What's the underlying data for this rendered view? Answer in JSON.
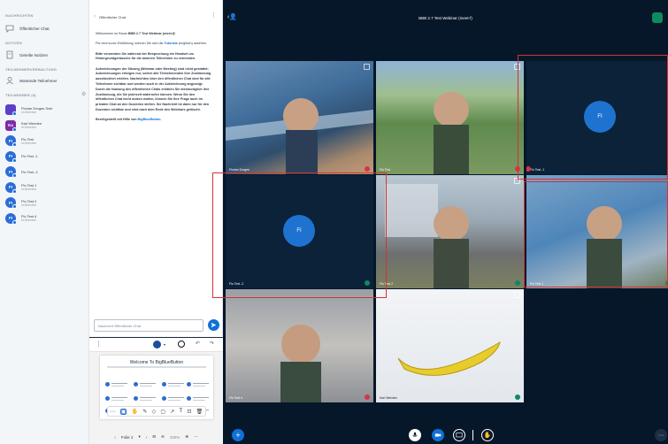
{
  "sidebar": {
    "messages_title": "NACHRICHTEN",
    "public_chat": "Öffentlicher Chat",
    "notes_title": "NOTIZEN",
    "shared_notes": "Geteilte Notizen",
    "management_title": "TEILNEHMERVERWALTUNG",
    "waiting_users": "Wartende Teilnehmer",
    "participants_title": "TEILNEHMER (8)",
    "users": [
      {
        "initials": "",
        "name": "Florian Dorges Schr",
        "sub": "im Betreiber",
        "color": "#5b3fc7"
      },
      {
        "initials": "Ka",
        "name": "Karl Wenden",
        "sub": "im Betreiber",
        "color": "#7b2aa8"
      },
      {
        "initials": "FI",
        "name": "Flo Test",
        "sub": "im Betreiber",
        "color": "#2b6cd6"
      },
      {
        "initials": "FI",
        "name": "Flo Test -1",
        "sub": "",
        "color": "#2b6cd6"
      },
      {
        "initials": "FI",
        "name": "Flo Test -2",
        "sub": "",
        "color": "#2b6cd6"
      },
      {
        "initials": "FI",
        "name": "Flo Test 1",
        "sub": "im Betreiber",
        "color": "#2b6cd6"
      },
      {
        "initials": "FI",
        "name": "Flo Test 2",
        "sub": "im Betreiber",
        "color": "#2b6cd6"
      },
      {
        "initials": "FI",
        "name": "Flo Test 4",
        "sub": "im Betreiber",
        "color": "#2b6cd6"
      }
    ]
  },
  "chat": {
    "title": "Öffentlicher Chat",
    "welcome_pre": "Willkommen im Raum ",
    "welcome_room": "BBB 2.7 Test Webinar (meet-f)",
    "welcome_post": "!",
    "p2_pre": "Für eine kurze Einführung, können Sie sich die ",
    "p2_link": "Tutorials",
    "p2_post": " (englisch) ansehen.",
    "p3": "Bitte verwenden Sie während der Besprechung ein Headset um Hintergrundgeräusche für die anderen Teilnehmer zu vermeiden.",
    "p4": "Aufzeichnungen der Sitzung (Webinar oder Meeting) sind nicht gestattet; Aufzeichnungen erfolgen nur, sofern alle Teilnehmenden ihre Zustimmung ausdrücklich erteilen. Nachrichten über den öffentlichen Chat sind für alle Teilnehmer sichtbar und werden auch in der Aufzeichnung angezeigt. Durch die Nutzung des öffentlichen Chats erklären Sie diesbezüglich ihre Zustimmung, die Sie jederzeit widerrufen können. Wenn Sie den öffentlichen Chat nicht nutzen wollen, können Sie Ihre Frage auch im privaten Chat an den Dozenten stellen. Sie Nachricht ist dann nur für den Dozenten sichtbar und sind nach dem Ende des Webinars gelöscht.",
    "p5_pre": "Bereitgestellt mit Hilfe von ",
    "p5_link": "BigBlueButton",
    "p5_post": ".",
    "input_placeholder": "Nachricht Öffentlicher Chat"
  },
  "presentation": {
    "slide_title": "Welcome To BigBlueButton",
    "page_label": "Folie 1",
    "zoom": "100%"
  },
  "video": {
    "meeting_title": "BBB 2.7 Test Webinar (meet-f)",
    "tiles": [
      {
        "label": "Florian Dorges",
        "initials": ""
      },
      {
        "label": "Flo Test",
        "initials": ""
      },
      {
        "label": "Flo Test -1",
        "initials": "FI"
      },
      {
        "label": "Flo Test -2",
        "initials": "FI"
      },
      {
        "label": "Flo Test 2",
        "initials": ""
      },
      {
        "label": "Flo Test 1",
        "initials": ""
      },
      {
        "label": "Flo Test 4",
        "initials": ""
      },
      {
        "label": "Karl Wenden",
        "initials": ""
      }
    ]
  },
  "colors": {
    "accent": "#0f70d7",
    "video_bg": "#06172a",
    "mute": "#d9334a",
    "highlight_frame": "#d23333"
  }
}
